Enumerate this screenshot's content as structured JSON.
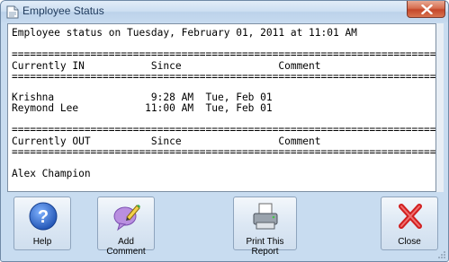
{
  "window": {
    "title": "Employee Status"
  },
  "report": {
    "heading": "Employee status on Tuesday, February 01, 2011 at 11:01 AM",
    "rule": "======================================================================",
    "in_header": "Currently IN           Since                Comment",
    "in_rows": [
      "Krishna                9:28 AM  Tue, Feb 01",
      "Reymond Lee           11:00 AM  Tue, Feb 01"
    ],
    "out_header": "Currently OUT          Since                Comment",
    "out_rows": [
      "Alex Champion"
    ]
  },
  "toolbar": {
    "help_label": "Help",
    "add_comment_label": "Add Comment",
    "print_label": "Print This Report",
    "close_label": "Close"
  },
  "icons": {
    "window": "document-icon",
    "help": "help-icon",
    "comment": "comment-icon",
    "print": "printer-icon",
    "close": "close-icon"
  },
  "colors": {
    "accent": "#2a5fb0",
    "close": "#c4302a"
  }
}
